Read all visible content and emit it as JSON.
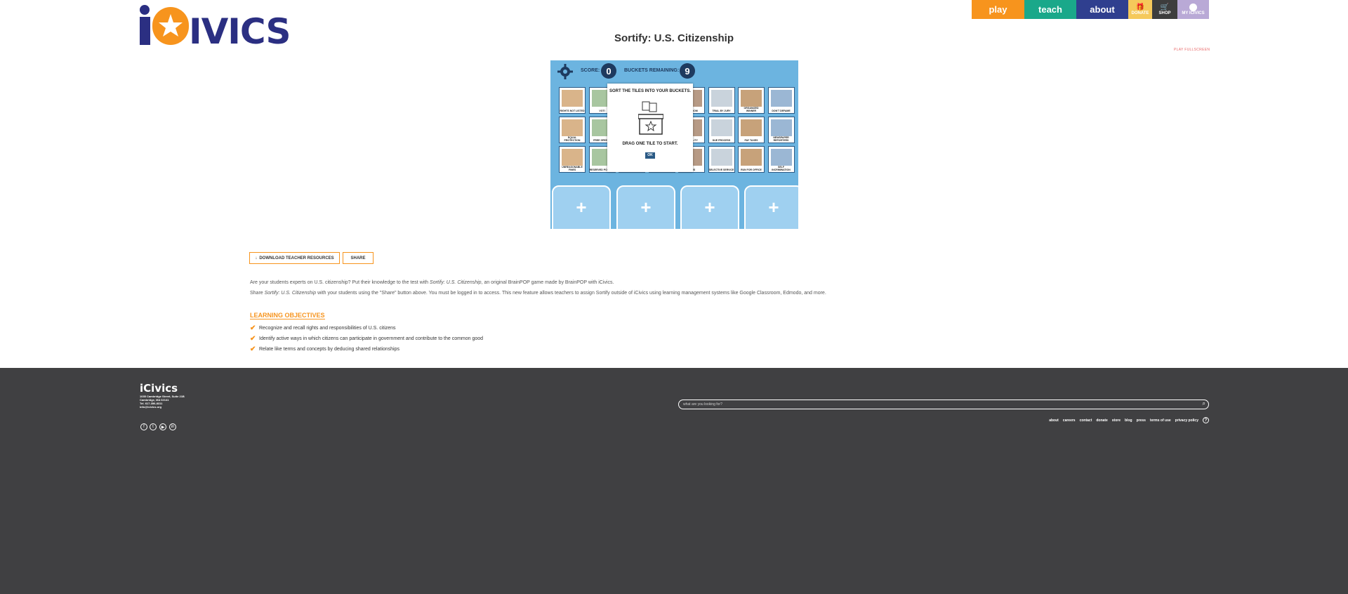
{
  "header": {
    "logo_text": "iCivics",
    "nav": [
      {
        "label": "play"
      },
      {
        "label": "teach"
      },
      {
        "label": "about"
      },
      {
        "label": "DONATE"
      },
      {
        "label": "SHOP"
      },
      {
        "label": "MY ICIVICS"
      }
    ],
    "colors": {
      "orange": "#f7941d",
      "navy": "#2b2f82"
    }
  },
  "page": {
    "title": "Sortify: U.S. Citizenship",
    "fullscreen_link": "PLAY FULLSCREEN"
  },
  "game": {
    "score_label": "SCORE:",
    "score_value": "0",
    "buckets_label": "BUCKETS REMAINING:",
    "buckets_value": "9",
    "tiles": [
      "RIGHTS NOT LISTED",
      "VOTI",
      "",
      "",
      "FREEDOM",
      "TRIAL BY JURY",
      "ORGANIZED WINNER",
      "DON'T DEFAME",
      "EQUAL PROTECTION",
      "FREE SPEECH",
      "",
      "",
      "EQUALITY",
      "DUE PROCESS",
      "PAY TAXES",
      "NEWSPAPER REPORTERS",
      "UNREASONABLE FINES",
      "RESERVED POWERS",
      "",
      "",
      "ARMS",
      "SELECTIVE SERVICE",
      "RUN FOR OFFICE",
      "SELF INCRIMINATION"
    ],
    "popup_title": "SORT THE TILES INTO YOUR BUCKETS.",
    "popup_instruction": "DRAG ONE TILE TO START.",
    "popup_ok": "OK",
    "bucket_symbol": "+"
  },
  "actions": {
    "download_label": "DOWNLOAD TEACHER RESOURCES",
    "share_label": "SHARE"
  },
  "description": {
    "p1_a": "Are your students experts on U.S. citizenship? Put their knowledge to the test with ",
    "p1_italic": "Sortify: U.S. Citizenship",
    "p1_b": ", an original BrainPOP game made by BrainPOP with iCivics.",
    "p2_a": "Share ",
    "p2_italic": "Sortify: U.S. Citizenship",
    "p2_b": " with your students using the \"Share\" button above. You must be logged in to access. This new feature allows teachers to assign Sortify outside of iCivics using learning management systems like Google Classroom, Edmodo, and more."
  },
  "objectives": {
    "title": "LEARNING OBJECTIVES",
    "items": [
      "Recognize and recall rights and responsibilities of U.S. citizens",
      "Identify active ways in which citizens can participate in government and contribute to the common good",
      "Relate like terms and concepts by deducing shared relationships"
    ]
  },
  "footer": {
    "logo_text": "iCivics",
    "address": [
      "1035 Cambridge Street, Suite 21B",
      "Cambridge, MA 02141",
      "Tel. 617-356-8311",
      "info@icivics.org"
    ],
    "social": [
      "facebook-icon",
      "twitter-icon",
      "youtube-icon",
      "linkedin-icon"
    ],
    "search_placeholder": "what are you looking for?",
    "links": [
      "about",
      "careers",
      "contact",
      "donate",
      "store",
      "blog",
      "press",
      "terms of use",
      "privacy policy"
    ],
    "help": "?"
  }
}
